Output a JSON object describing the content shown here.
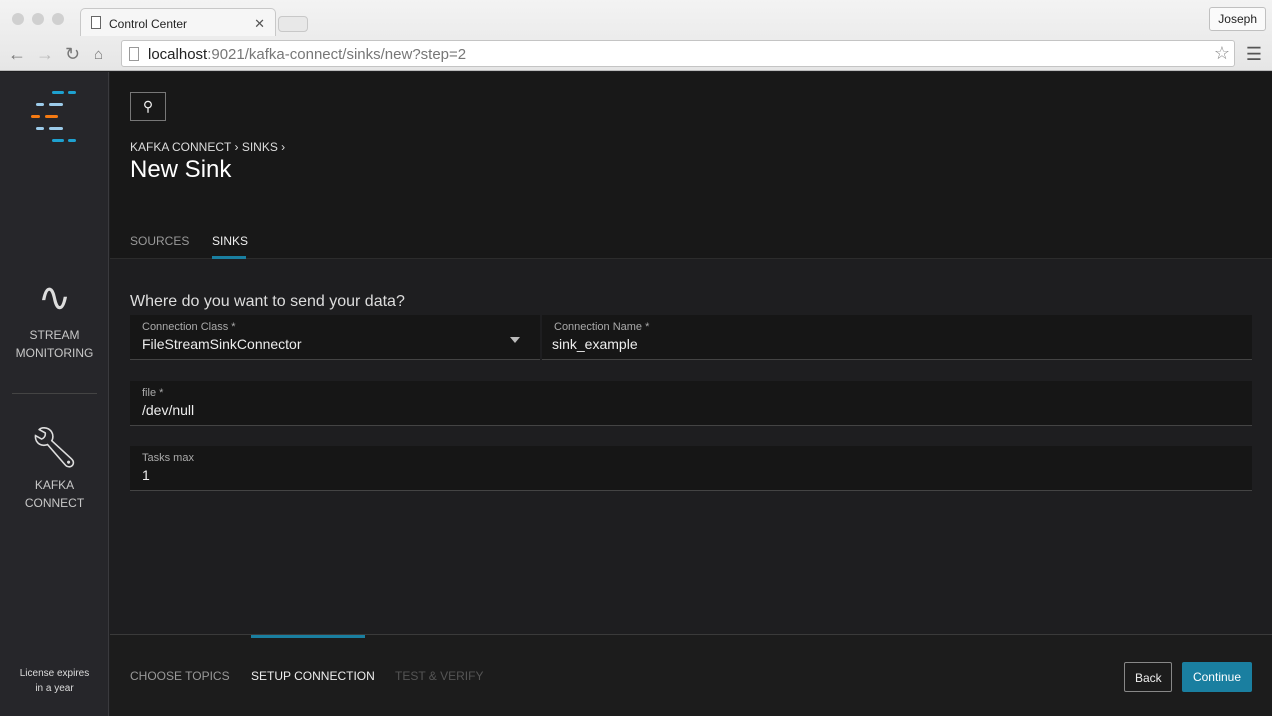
{
  "browser": {
    "tab_title": "Control Center",
    "user": "Joseph",
    "url_host": "localhost",
    "url_rest": ":9021/kafka-connect/sinks/new?step=2"
  },
  "sidebar": {
    "items": [
      {
        "label1": "STREAM",
        "label2": "MONITORING"
      },
      {
        "label1": "KAFKA",
        "label2": "CONNECT"
      }
    ],
    "license1": "License expires",
    "license2": "in a year"
  },
  "header": {
    "breadcrumb": [
      "KAFKA CONNECT",
      "SINKS"
    ],
    "title": "New Sink",
    "tabs": [
      "SOURCES",
      "SINKS"
    ]
  },
  "form": {
    "question": "Where do you want to send your data?",
    "connection_class": {
      "label": "Connection Class *",
      "value": "FileStreamSinkConnector"
    },
    "connection_name": {
      "label": "Connection Name *",
      "value": "sink_example"
    },
    "file": {
      "label": "file *",
      "value": "/dev/null"
    },
    "tasks_max": {
      "label": "Tasks max",
      "value": "1"
    }
  },
  "footer": {
    "steps": [
      "CHOOSE TOPICS",
      "SETUP CONNECTION",
      "TEST & VERIFY"
    ],
    "back": "Back",
    "continue": "Continue"
  },
  "colors": {
    "accent": "#1a7fa0"
  }
}
